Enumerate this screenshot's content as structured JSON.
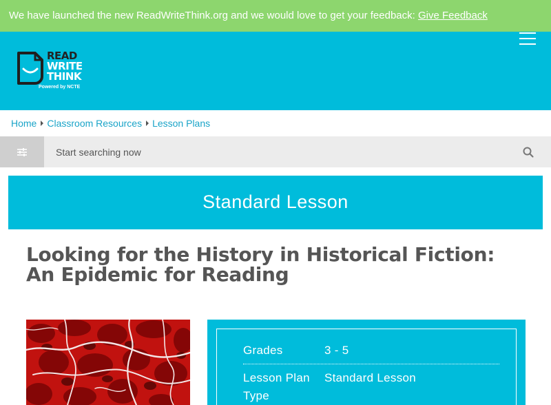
{
  "banner": {
    "message": "We have launched the new ReadWriteThink.org and we would love to get your feedback:",
    "link_label": "Give Feedback"
  },
  "header": {
    "logo": {
      "line1": "READ",
      "line2": "WRITE",
      "line3": "THINK",
      "tagline": "Powered by NCTE"
    },
    "menu_icon": "hamburger-menu-icon"
  },
  "breadcrumb": [
    "Home",
    "Classroom Resources",
    "Lesson Plans"
  ],
  "search": {
    "placeholder": "Start searching now",
    "value": ""
  },
  "lesson_type_banner": "Standard Lesson",
  "page_title": "Looking for the History in Historical Fiction: An Epidemic for Reading",
  "details": [
    {
      "label": "Grades",
      "value": "3 - 5"
    },
    {
      "label": "Lesson Plan Type",
      "value": "Standard Lesson"
    }
  ],
  "colors": {
    "banner_green": "#8dd66e",
    "brand_cyan": "#00bcdb",
    "link_blue": "#1aa4c8",
    "title_gray": "#555555"
  }
}
